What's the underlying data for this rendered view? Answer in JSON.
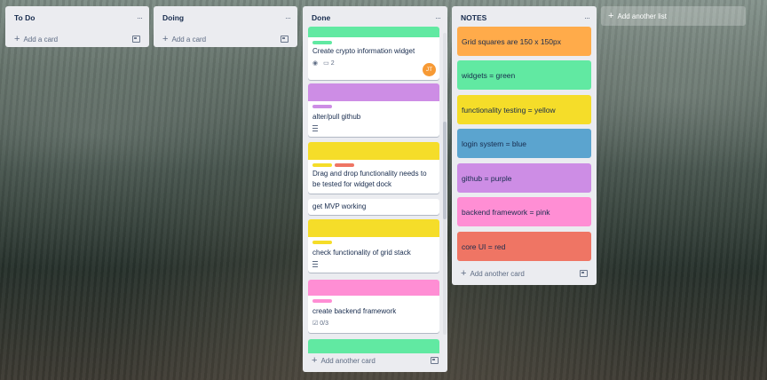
{
  "lists": {
    "todo": {
      "title": "To Do",
      "add_card": "Add a card"
    },
    "doing": {
      "title": "Doing",
      "add_card": "Add a card"
    },
    "done": {
      "title": "Done",
      "add_card": "Add another card",
      "cards": [
        {
          "title": "Create crypto information widget",
          "watch_icon": "eye-icon",
          "comments": "2",
          "member_initials": "JT"
        },
        {
          "title": "alter/pull github"
        },
        {
          "title": "Drag and drop functionality needs to be tested for widget dock"
        },
        {
          "title": "get MVP working"
        },
        {
          "title": "check functionality of grid stack"
        },
        {
          "title": "create backend framework",
          "checklist": "0/3"
        }
      ]
    },
    "notes": {
      "title": "NOTES",
      "add_card": "Add another card",
      "items": [
        {
          "text": "Grid squares are 150 x 150px",
          "color": "#ffab4a"
        },
        {
          "text": "widgets = green",
          "color": "#61e9a2"
        },
        {
          "text": "functionality testing = yellow",
          "color": "#f5dd29"
        },
        {
          "text": "login system = blue",
          "color": "#5ba4cf"
        },
        {
          "text": "github = purple",
          "color": "#cd8de5"
        },
        {
          "text": "backend framework = pink",
          "color": "#ff8ed4"
        },
        {
          "text": "core UI = red",
          "color": "#ef7564"
        }
      ]
    }
  },
  "add_list": "Add another list",
  "list_menu": "···",
  "colors": {
    "green": "#61e9a2",
    "purple": "#cd8de5",
    "yellow": "#f5dd29",
    "red": "#ef7564",
    "pink": "#ff8ed4"
  }
}
